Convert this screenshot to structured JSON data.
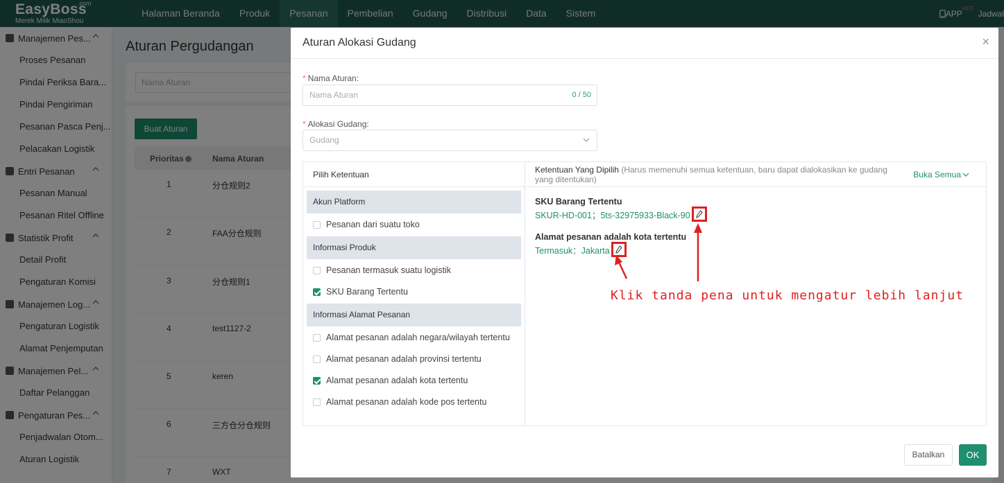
{
  "brand": {
    "name": "EasyBoss",
    "com": ".com",
    "tagline": "Merek Milik MiaoShou"
  },
  "topnav": {
    "items": [
      "Halaman Beranda",
      "Produk",
      "Pesanan",
      "Pembelian",
      "Gudang",
      "Distribusi",
      "Data",
      "Sistem"
    ],
    "active": "Pesanan",
    "app_label": "APP",
    "hot_label": "HOT",
    "schedule_label": "Jadwal"
  },
  "sidebar": {
    "groups": [
      {
        "label": "Manajemen Pes...",
        "items": [
          "Proses Pesanan",
          "Pindai Periksa Bara...",
          "Pindai Pengiriman",
          "Pesanan Pasca Penj...",
          "Pelacakan Logistik"
        ]
      },
      {
        "label": "Entri Pesanan",
        "items": [
          "Pesanan Manual",
          "Pesanan Ritel Offline"
        ]
      },
      {
        "label": "Statistik Profit",
        "items": [
          "Detail Profit",
          "Pengaturan Komisi"
        ]
      },
      {
        "label": "Manajemen Log...",
        "items": [
          "Pengaturan Logistik",
          "Alamat Penjemputan"
        ]
      },
      {
        "label": "Manajemen Pel...",
        "items": [
          "Daftar Pelanggan"
        ]
      },
      {
        "label": "Pengaturan Pes...",
        "items": [
          "Penjadwalan Otom...",
          "Aturan Logistik"
        ]
      }
    ]
  },
  "page": {
    "title": "Aturan Pergudangan",
    "search_placeholder": "Nama Aturan",
    "create_button": "Buat Aturan",
    "table": {
      "headers": [
        "Prioritas",
        "Nama Aturan"
      ],
      "rows": [
        [
          "1",
          "分仓规则2"
        ],
        [
          "2",
          "FAA分仓规则"
        ],
        [
          "3",
          "分仓规则1"
        ],
        [
          "4",
          "test1127-2"
        ],
        [
          "5",
          "keren"
        ],
        [
          "6",
          "三方仓分仓规则"
        ],
        [
          "7",
          "WXT"
        ]
      ]
    }
  },
  "modal": {
    "title": "Aturan Alokasi Gudang",
    "name_label": "Nama Aturan:",
    "name_placeholder": "Nama Aturan",
    "name_counter": "0 / 50",
    "warehouse_label": "Alokasi Gudang:",
    "warehouse_placeholder": "Gudang",
    "left_header": "Pilih Ketentuan",
    "sections": [
      {
        "title": "Akun Platform",
        "options": [
          {
            "label": "Pesanan dari suatu toko",
            "checked": false
          }
        ]
      },
      {
        "title": "Informasi Produk",
        "options": [
          {
            "label": "Pesanan termasuk suatu logistik",
            "checked": false
          },
          {
            "label": "SKU Barang Tertentu",
            "checked": true
          }
        ]
      },
      {
        "title": "Informasi Alamat Pesanan",
        "options": [
          {
            "label": "Alamat pesanan adalah negara/wilayah tertentu",
            "checked": false
          },
          {
            "label": "Alamat pesanan adalah provinsi tertentu",
            "checked": false
          },
          {
            "label": "Alamat pesanan adalah kota tertentu",
            "checked": true
          },
          {
            "label": "Alamat pesanan adalah kode pos tertentu",
            "checked": false
          }
        ]
      }
    ],
    "right_header": "Ketentuan Yang Dipilih",
    "right_header_note": "(Harus memenuhi semua ketentuan, baru dapat dialokasikan ke gudang yang ditentukan)",
    "expand_all": "Buka Semua",
    "selected": [
      {
        "title": "SKU Barang Tertentu",
        "value": "SKUR-HD-001；5ts-32975933-Black-90"
      },
      {
        "title": "Alamat pesanan adalah kota tertentu",
        "value": "Termasuk：Jakarta"
      }
    ],
    "annotation": "Klik tanda pena untuk mengatur lebih lanjut",
    "cancel_button": "Batalkan",
    "ok_button": "OK"
  },
  "colors": {
    "brand_dark": "#1f5a4d",
    "accent": "#1f8f6f",
    "annotation": "#e02020"
  }
}
